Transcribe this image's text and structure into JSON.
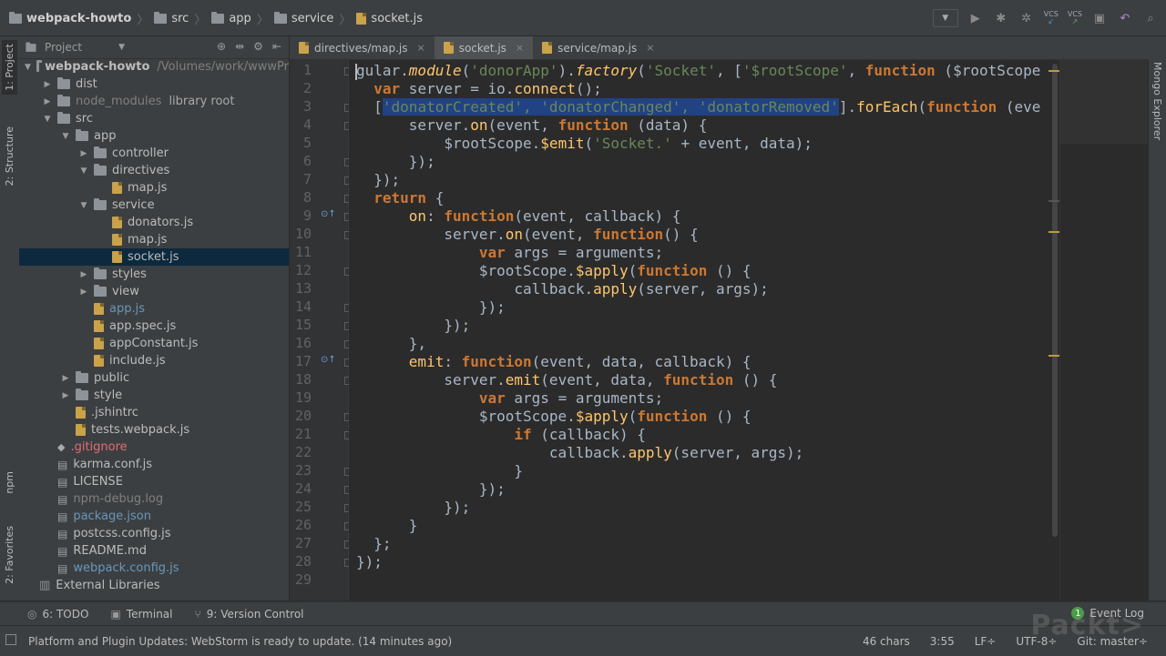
{
  "breadcrumbs": [
    {
      "label": "webpack-howto",
      "kind": "folder"
    },
    {
      "label": "src",
      "kind": "folder"
    },
    {
      "label": "app",
      "kind": "folder"
    },
    {
      "label": "service",
      "kind": "folder"
    },
    {
      "label": "socket.js",
      "kind": "js"
    }
  ],
  "toolbar": {
    "vcs1": "VCS",
    "vcs2": "VCS"
  },
  "left_strip": {
    "project": "1: Project",
    "structure": "2: Structure",
    "npm": "npm",
    "favorites": "2: Favorites"
  },
  "right_strip": {
    "mongo": "Mongo Explorer"
  },
  "project_panel": {
    "title": "Project",
    "tree": [
      {
        "label": "webpack-howto",
        "suffix": "/Volumes/work/wwwPr",
        "indent": 0,
        "arrow": "down",
        "icon": "folder",
        "bold": true
      },
      {
        "label": "dist",
        "indent": 1,
        "arrow": "right",
        "icon": "folder"
      },
      {
        "label": "node_modules",
        "suffix": "library root",
        "indent": 1,
        "arrow": "right",
        "icon": "folder",
        "muted": true
      },
      {
        "label": "src",
        "indent": 1,
        "arrow": "down",
        "icon": "folder"
      },
      {
        "label": "app",
        "indent": 2,
        "arrow": "down",
        "icon": "folder"
      },
      {
        "label": "controller",
        "indent": 3,
        "arrow": "right",
        "icon": "folder"
      },
      {
        "label": "directives",
        "indent": 3,
        "arrow": "down",
        "icon": "folder"
      },
      {
        "label": "map.js",
        "indent": 4,
        "arrow": "",
        "icon": "js"
      },
      {
        "label": "service",
        "indent": 3,
        "arrow": "down",
        "icon": "folder"
      },
      {
        "label": "donators.js",
        "indent": 4,
        "arrow": "",
        "icon": "js"
      },
      {
        "label": "map.js",
        "indent": 4,
        "arrow": "",
        "icon": "js"
      },
      {
        "label": "socket.js",
        "indent": 4,
        "arrow": "",
        "icon": "js",
        "selected": true
      },
      {
        "label": "styles",
        "indent": 3,
        "arrow": "right",
        "icon": "folder"
      },
      {
        "label": "view",
        "indent": 3,
        "arrow": "right",
        "icon": "folder"
      },
      {
        "label": "app.js",
        "indent": 3,
        "arrow": "",
        "icon": "js",
        "color": "blue"
      },
      {
        "label": "app.spec.js",
        "indent": 3,
        "arrow": "",
        "icon": "js"
      },
      {
        "label": "appConstant.js",
        "indent": 3,
        "arrow": "",
        "icon": "js"
      },
      {
        "label": "include.js",
        "indent": 3,
        "arrow": "",
        "icon": "js"
      },
      {
        "label": "public",
        "indent": 2,
        "arrow": "right",
        "icon": "folder"
      },
      {
        "label": "style",
        "indent": 2,
        "arrow": "right",
        "icon": "folder"
      },
      {
        "label": ".jshintrc",
        "indent": 2,
        "arrow": "",
        "icon": "js"
      },
      {
        "label": "tests.webpack.js",
        "indent": 2,
        "arrow": "",
        "icon": "js"
      },
      {
        "label": ".gitignore",
        "indent": 1,
        "arrow": "",
        "icon": "git",
        "color": "red"
      },
      {
        "label": "karma.conf.js",
        "indent": 1,
        "arrow": "",
        "icon": "file"
      },
      {
        "label": "LICENSE",
        "indent": 1,
        "arrow": "",
        "icon": "file"
      },
      {
        "label": "npm-debug.log",
        "indent": 1,
        "arrow": "",
        "icon": "file",
        "muted": true
      },
      {
        "label": "package.json",
        "indent": 1,
        "arrow": "",
        "icon": "file",
        "color": "blue"
      },
      {
        "label": "postcss.config.js",
        "indent": 1,
        "arrow": "",
        "icon": "file"
      },
      {
        "label": "README.md",
        "indent": 1,
        "arrow": "",
        "icon": "file"
      },
      {
        "label": "webpack.config.js",
        "indent": 1,
        "arrow": "",
        "icon": "file",
        "color": "blue"
      },
      {
        "label": "External Libraries",
        "indent": 0,
        "arrow": "",
        "icon": "lib"
      }
    ]
  },
  "editor_tabs": [
    {
      "label": "directives/map.js",
      "active": false
    },
    {
      "label": "socket.js",
      "active": true
    },
    {
      "label": "service/map.js",
      "active": false
    }
  ],
  "line_numbers": [
    "1",
    "2",
    "3",
    "4",
    "5",
    "6",
    "7",
    "8",
    "9",
    "10",
    "11",
    "12",
    "13",
    "14",
    "15",
    "16",
    "17",
    "18",
    "19",
    "20",
    "21",
    "22",
    "23",
    "24",
    "25",
    "26",
    "27",
    "28",
    "29"
  ],
  "code_lines": [
    [
      [
        "gular.",
        "p"
      ],
      [
        "module",
        "fni"
      ],
      [
        "(",
        "p"
      ],
      [
        "'donorApp'",
        "s"
      ],
      [
        ").",
        "p"
      ],
      [
        "factory",
        "fni"
      ],
      [
        "(",
        "p"
      ],
      [
        "'Socket'",
        "s"
      ],
      [
        ", [",
        "p"
      ],
      [
        "'$rootScope'",
        "s"
      ],
      [
        ", ",
        "p"
      ],
      [
        "function",
        "k"
      ],
      [
        " ($rootScope",
        "p"
      ]
    ],
    [
      [
        "  ",
        "p"
      ],
      [
        "var",
        "k"
      ],
      [
        " server = io.",
        "p"
      ],
      [
        "connect",
        "fn"
      ],
      [
        "();",
        "p"
      ]
    ],
    [
      [
        "  [",
        "p"
      ],
      [
        "'donatorCreated', 'donatorChanged', 'donatorRemoved'",
        "ssel"
      ],
      [
        "].",
        "p"
      ],
      [
        "forEach",
        "fn"
      ],
      [
        "(",
        "p"
      ],
      [
        "function",
        "k"
      ],
      [
        " (eve",
        "p"
      ]
    ],
    [
      [
        "      server.",
        "p"
      ],
      [
        "on",
        "fn"
      ],
      [
        "(event, ",
        "p"
      ],
      [
        "function",
        "k"
      ],
      [
        " (data) {",
        "p"
      ]
    ],
    [
      [
        "          $rootScope.",
        "p"
      ],
      [
        "$emit",
        "fn"
      ],
      [
        "(",
        "p"
      ],
      [
        "'Socket.'",
        "s"
      ],
      [
        " + event, data);",
        "p"
      ]
    ],
    [
      [
        "      });",
        "p"
      ]
    ],
    [
      [
        "  });",
        "p"
      ]
    ],
    [
      [
        "  ",
        "p"
      ],
      [
        "return",
        "k"
      ],
      [
        " {",
        "p"
      ]
    ],
    [
      [
        "      ",
        "p"
      ],
      [
        "on",
        "fn"
      ],
      [
        ": ",
        "p"
      ],
      [
        "function",
        "k"
      ],
      [
        "(event, callback) {",
        "p"
      ]
    ],
    [
      [
        "          server.",
        "p"
      ],
      [
        "on",
        "fn"
      ],
      [
        "(event, ",
        "p"
      ],
      [
        "function",
        "k"
      ],
      [
        "() {",
        "p"
      ]
    ],
    [
      [
        "              ",
        "p"
      ],
      [
        "var",
        "k"
      ],
      [
        " args = arguments;",
        "p"
      ]
    ],
    [
      [
        "              $rootScope.",
        "p"
      ],
      [
        "$apply",
        "fn"
      ],
      [
        "(",
        "p"
      ],
      [
        "function",
        "k"
      ],
      [
        " () {",
        "p"
      ]
    ],
    [
      [
        "                  callback.",
        "p"
      ],
      [
        "apply",
        "fn"
      ],
      [
        "(server, args);",
        "p"
      ]
    ],
    [
      [
        "              });",
        "p"
      ]
    ],
    [
      [
        "          });",
        "p"
      ]
    ],
    [
      [
        "      },",
        "p"
      ]
    ],
    [
      [
        "      ",
        "p"
      ],
      [
        "emit",
        "fn"
      ],
      [
        ": ",
        "p"
      ],
      [
        "function",
        "k"
      ],
      [
        "(event, data, callback) {",
        "p"
      ]
    ],
    [
      [
        "          server.",
        "p"
      ],
      [
        "emit",
        "fn"
      ],
      [
        "(event, data, ",
        "p"
      ],
      [
        "function",
        "k"
      ],
      [
        " () {",
        "p"
      ]
    ],
    [
      [
        "              ",
        "p"
      ],
      [
        "var",
        "k"
      ],
      [
        " args = arguments;",
        "p"
      ]
    ],
    [
      [
        "              $rootScope.",
        "p"
      ],
      [
        "$apply",
        "fn"
      ],
      [
        "(",
        "p"
      ],
      [
        "function",
        "k"
      ],
      [
        " () {",
        "p"
      ]
    ],
    [
      [
        "                  ",
        "p"
      ],
      [
        "if",
        "k"
      ],
      [
        " (callback) {",
        "p"
      ]
    ],
    [
      [
        "                      callback.",
        "p"
      ],
      [
        "apply",
        "fn"
      ],
      [
        "(server, args);",
        "p"
      ]
    ],
    [
      [
        "                  }",
        "p"
      ]
    ],
    [
      [
        "              });",
        "p"
      ]
    ],
    [
      [
        "          });",
        "p"
      ]
    ],
    [
      [
        "      }",
        "p"
      ]
    ],
    [
      [
        "  };",
        "p"
      ]
    ],
    [
      [
        "});",
        "p"
      ]
    ],
    [
      [
        "",
        "p"
      ]
    ]
  ],
  "bottom_tabs": [
    {
      "label": "6: TODO",
      "icon": "todo-icon"
    },
    {
      "label": "Terminal",
      "icon": "terminal-icon"
    },
    {
      "label": "9: Version Control",
      "icon": "vcs-icon"
    }
  ],
  "event_log": {
    "badge": "1",
    "label": "Event Log"
  },
  "status": {
    "message": "Platform and Plugin Updates: WebStorm is ready to update. (14 minutes ago)",
    "chars": "46 chars",
    "position": "3:55",
    "line_sep": "LF÷",
    "encoding": "UTF-8÷",
    "git": "Git: master÷"
  },
  "watermark": "Packt>"
}
